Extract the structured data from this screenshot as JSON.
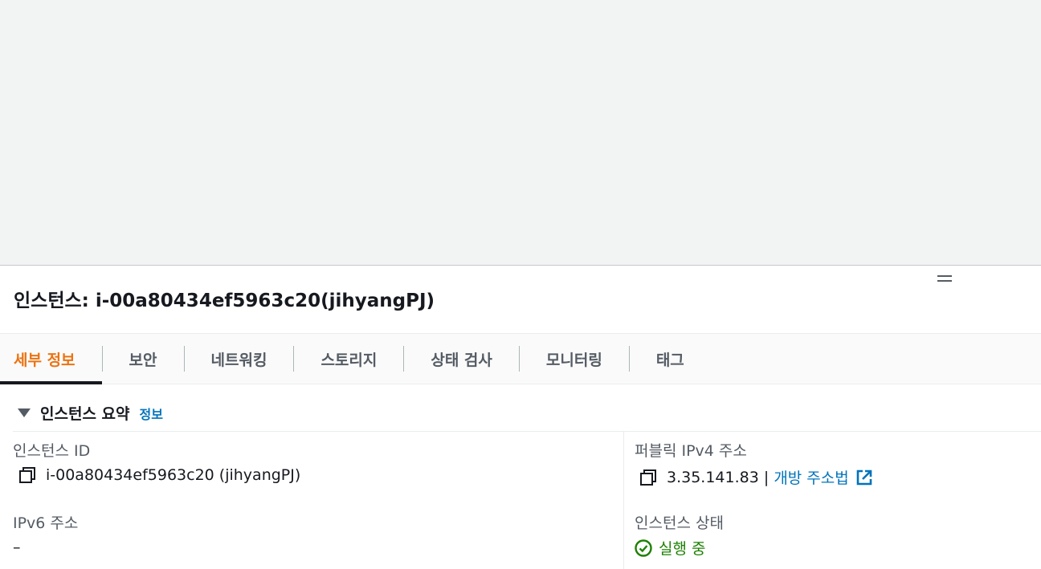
{
  "panel": {
    "title": "인스턴스: i-00a80434ef5963c20(jihyangPJ)"
  },
  "tabs": [
    {
      "label": "세부 정보",
      "active": true
    },
    {
      "label": "보안",
      "active": false
    },
    {
      "label": "네트워킹",
      "active": false
    },
    {
      "label": "스토리지",
      "active": false
    },
    {
      "label": "상태 검사",
      "active": false
    },
    {
      "label": "모니터링",
      "active": false
    },
    {
      "label": "태그",
      "active": false
    }
  ],
  "summary": {
    "title": "인스턴스 요약",
    "info_link": "정보"
  },
  "fields": {
    "instance_id": {
      "label": "인스턴스 ID",
      "value": "i-00a80434ef5963c20 (jihyangPJ)"
    },
    "public_ipv4": {
      "label": "퍼블릭 IPv4 주소",
      "value": "3.35.141.83",
      "separator": " | ",
      "open_link": "개방 주소법"
    },
    "ipv6": {
      "label": "IPv6 주소",
      "value": "–"
    },
    "instance_state": {
      "label": "인스턴스 상태",
      "value": "실행 중"
    }
  },
  "colors": {
    "active_tab": "#ec7211",
    "link": "#0073bb",
    "running": "#1d8102"
  }
}
